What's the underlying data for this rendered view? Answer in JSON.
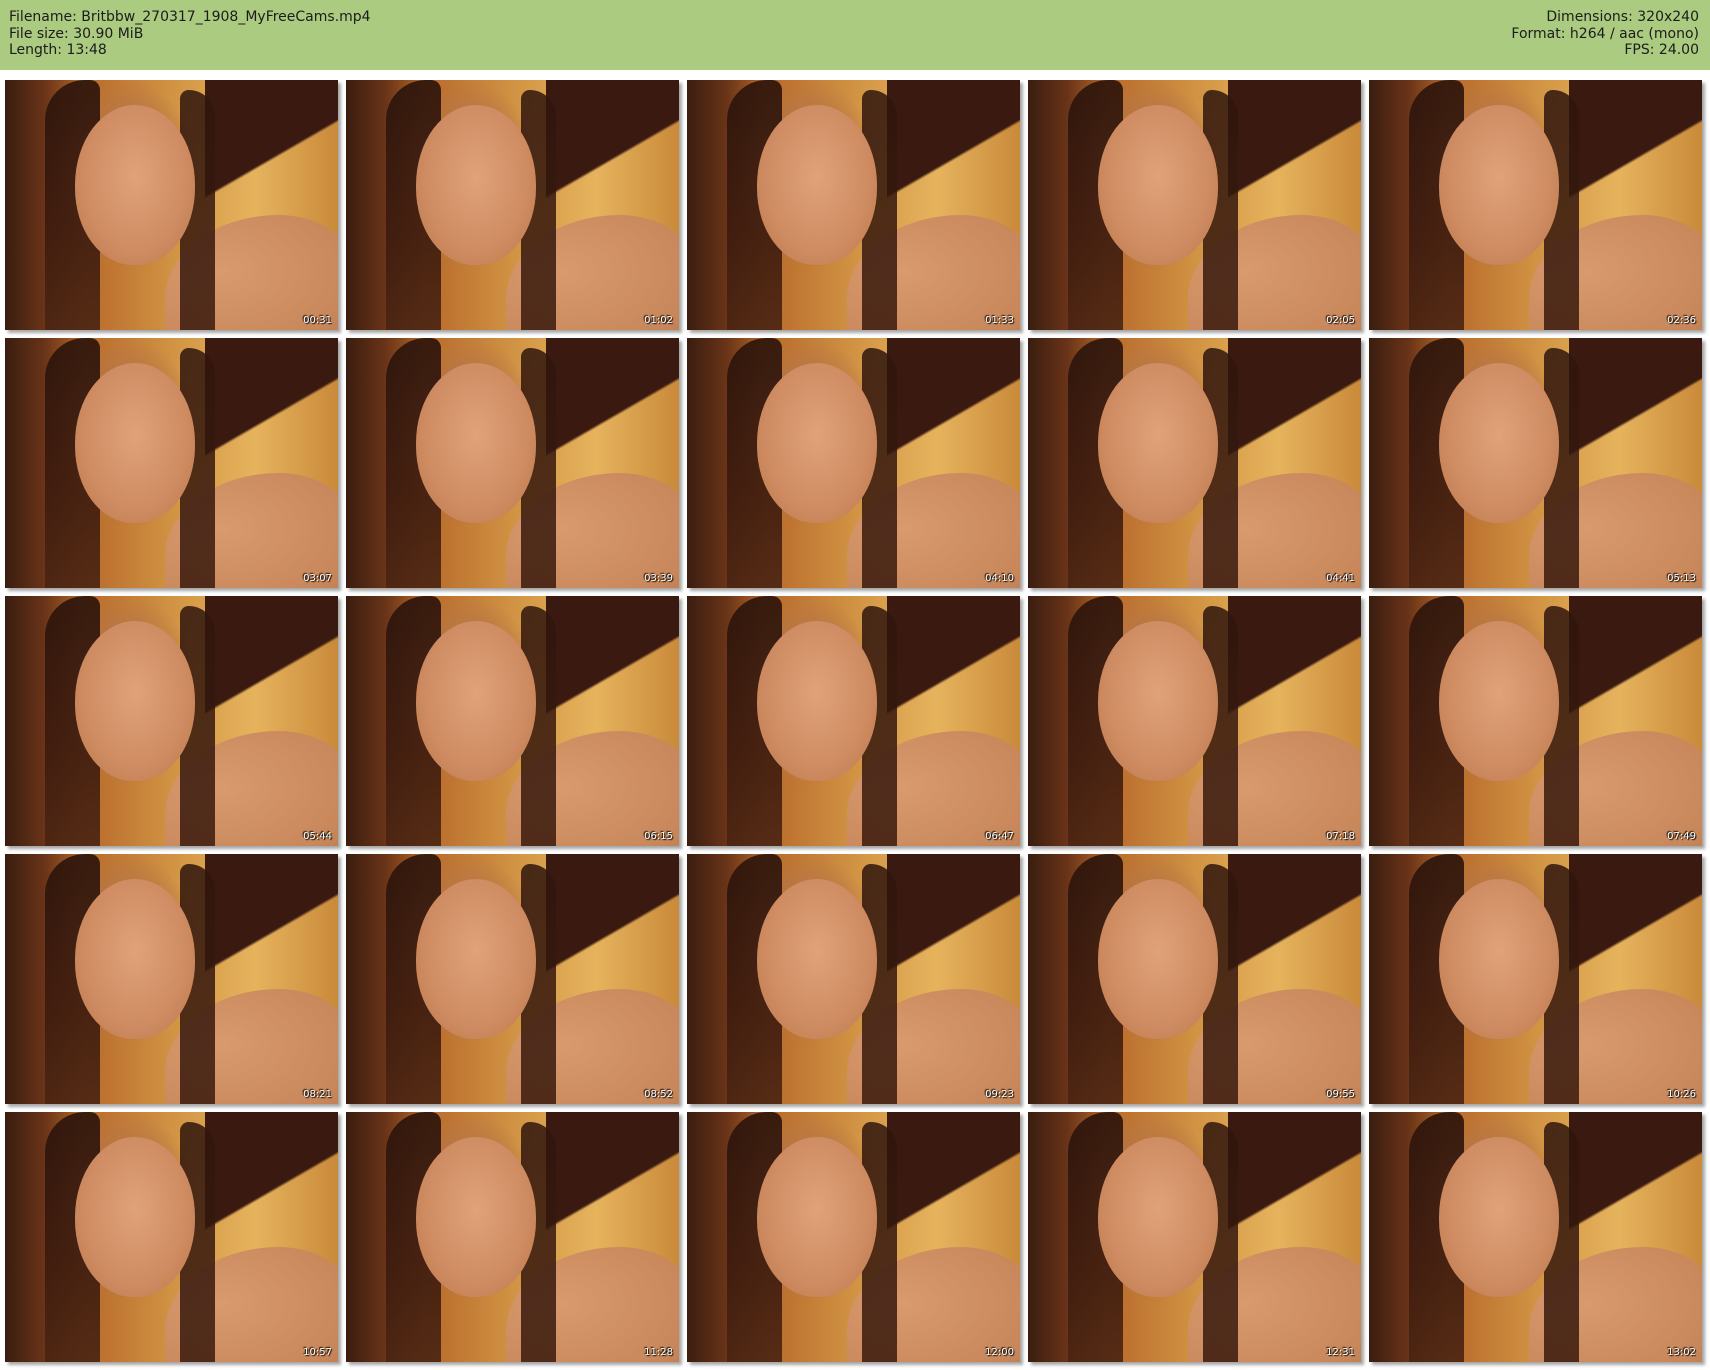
{
  "header": {
    "filename": "Filename: Britbbw_270317_1908_MyFreeCams.mp4",
    "file_size": "File size: 30.90 MiB",
    "length": "Length: 13:48",
    "dimensions": "Dimensions: 320x240",
    "format": "Format: h264 / aac (mono)",
    "fps": "FPS: 24.00"
  },
  "thumbnails": [
    {
      "timestamp": "00:31"
    },
    {
      "timestamp": "01:02"
    },
    {
      "timestamp": "01:33"
    },
    {
      "timestamp": "02:05"
    },
    {
      "timestamp": "02:36"
    },
    {
      "timestamp": "03:07"
    },
    {
      "timestamp": "03:39"
    },
    {
      "timestamp": "04:10"
    },
    {
      "timestamp": "04:41"
    },
    {
      "timestamp": "05:13"
    },
    {
      "timestamp": "05:44"
    },
    {
      "timestamp": "06:15"
    },
    {
      "timestamp": "06:47"
    },
    {
      "timestamp": "07:18"
    },
    {
      "timestamp": "07:49"
    },
    {
      "timestamp": "08:21"
    },
    {
      "timestamp": "08:52"
    },
    {
      "timestamp": "09:23"
    },
    {
      "timestamp": "09:55"
    },
    {
      "timestamp": "10:26"
    },
    {
      "timestamp": "10:57"
    },
    {
      "timestamp": "11:28"
    },
    {
      "timestamp": "12:00"
    },
    {
      "timestamp": "12:31"
    },
    {
      "timestamp": "13:02"
    }
  ]
}
